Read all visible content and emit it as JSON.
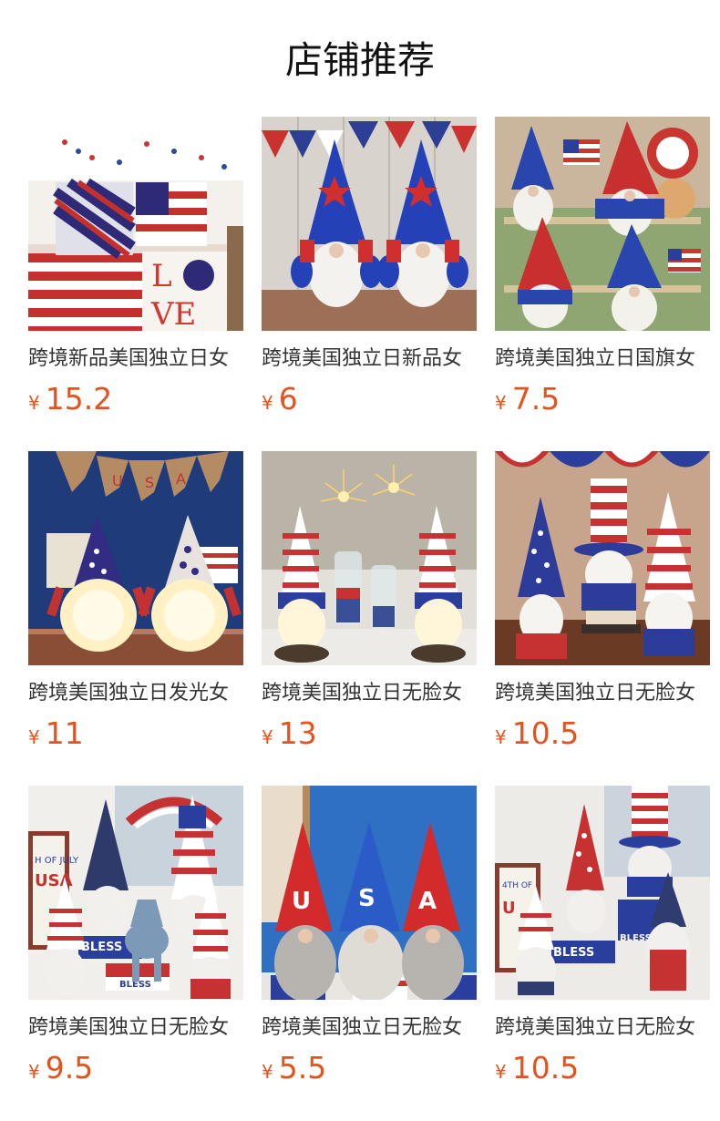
{
  "header": {
    "title": "店铺推荐"
  },
  "colors": {
    "price": "#e2531e",
    "name": "#333333",
    "title": "#111111",
    "flag_red": "#d22c2c",
    "flag_blue": "#2a3e9e"
  },
  "products": [
    {
      "name": "跨境新品美国独立日女",
      "currency": "¥",
      "price": "15.2",
      "image_icon": "patriotic-pillows-image"
    },
    {
      "name": "跨境美国独立日新品女",
      "currency": "¥",
      "price": "6",
      "image_icon": "blue-gnome-pair-image"
    },
    {
      "name": "跨境美国独立日国旗女",
      "currency": "¥",
      "price": "7.5",
      "image_icon": "gnome-group-flags-image"
    },
    {
      "name": "跨境美国独立日发光女",
      "currency": "¥",
      "price": "11",
      "image_icon": "glowing-gnome-pair-image"
    },
    {
      "name": "跨境美国独立日无脸女",
      "currency": "¥",
      "price": "13",
      "image_icon": "gnome-fireworks-image"
    },
    {
      "name": "跨境美国独立日无脸女",
      "currency": "¥",
      "price": "10.5",
      "image_icon": "uncle-sam-gnomes-image"
    },
    {
      "name": "跨境美国独立日无脸女",
      "currency": "¥",
      "price": "9.5",
      "image_icon": "fourth-of-july-gnomes-image"
    },
    {
      "name": "跨境美国独立日无脸女",
      "currency": "¥",
      "price": "5.5",
      "image_icon": "usa-hat-gnomes-image"
    },
    {
      "name": "跨境美国独立日无脸女",
      "currency": "¥",
      "price": "10.5",
      "image_icon": "god-bless-gnomes-image"
    }
  ]
}
